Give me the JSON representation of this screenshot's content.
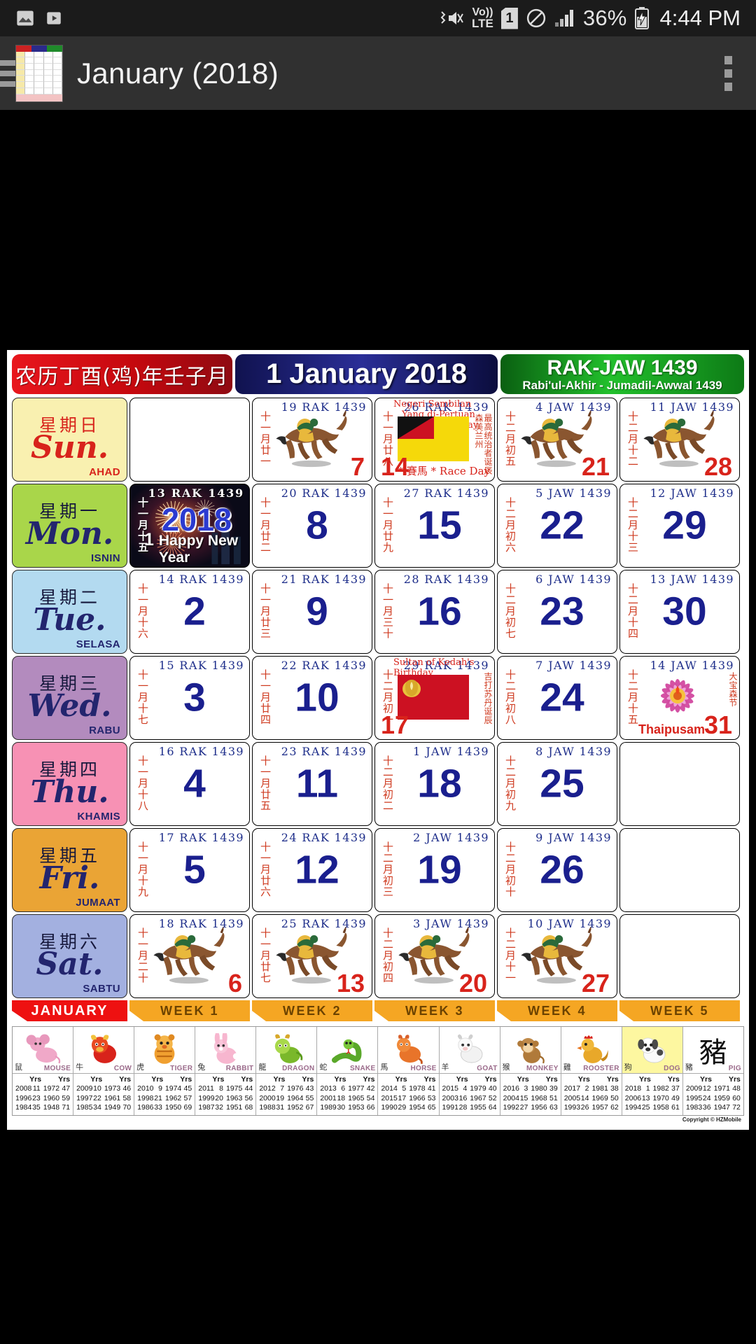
{
  "statusbar": {
    "icons": [
      "image-icon",
      "play-icon"
    ],
    "vibrate_icon": "vibrate-mute-icon",
    "volte": "Vo))\nLTE",
    "volte_line1": "Vo))",
    "volte_line2": "LTE",
    "sim": "1",
    "dnd_icon": "do-not-disturb-icon",
    "signal_icon": "signal-bars-icon",
    "battery_percent": "36%",
    "battery_icon": "battery-charging-icon",
    "time": "4:44 PM"
  },
  "appbar": {
    "menu_icon": "hamburger-menu-icon",
    "app_icon": "calendar-app-icon",
    "title": "January (2018)",
    "overflow_icon": "overflow-menu-icon"
  },
  "banner": {
    "chinese": "农历丁酉(鸡)年壬子月",
    "gregorian": "1 January 2018",
    "hijri_short": "RAK-JAW 1439",
    "hijri_long": "Rabi'ul-Akhir  -  Jumadil-Awwal 1439"
  },
  "weekdays": [
    {
      "cn": "星期日",
      "en": "Sun.",
      "ms": "AHAD",
      "bg": "#f9f0b0",
      "cn_color": "#d8231b",
      "en_color": "#d8231b",
      "ms_color": "#d8231b"
    },
    {
      "cn": "星期一",
      "en": "Mon.",
      "ms": "ISNIN",
      "bg": "#a9d64a",
      "cn_color": "#16183c",
      "en_color": "#23256e",
      "ms_color": "#23256e"
    },
    {
      "cn": "星期二",
      "en": "Tue.",
      "ms": "SELASA",
      "bg": "#b3daf0",
      "cn_color": "#16183c",
      "en_color": "#23256e",
      "ms_color": "#23256e"
    },
    {
      "cn": "星期三",
      "en": "Wed.",
      "ms": "RABU",
      "bg": "#b38bbe",
      "cn_color": "#16183c",
      "en_color": "#23256e",
      "ms_color": "#23256e"
    },
    {
      "cn": "星期四",
      "en": "Thu.",
      "ms": "KHAMIS",
      "bg": "#f791b4",
      "cn_color": "#16183c",
      "en_color": "#23256e",
      "ms_color": "#23256e"
    },
    {
      "cn": "星期五",
      "en": "Fri.",
      "ms": "JUMAAT",
      "bg": "#eaa435",
      "cn_color": "#16183c",
      "en_color": "#23256e",
      "ms_color": "#23256e"
    },
    {
      "cn": "星期六",
      "en": "Sat.",
      "ms": "SABTU",
      "bg": "#a3b0e0",
      "cn_color": "#16183c",
      "en_color": "#23256e",
      "ms_color": "#23256e"
    }
  ],
  "month_tag": "JANUARY",
  "week_tags": [
    "WEEK  1",
    "WEEK  2",
    "WEEK  3",
    "WEEK  4",
    "WEEK  5"
  ],
  "weeks": [
    [
      {
        "type": "empty"
      },
      {
        "type": "newyear",
        "day": "1",
        "hijri": "13 RAK 1439",
        "lunar": "十一月十五",
        "label": "Happy New Year"
      },
      {
        "type": "normal",
        "day": "2",
        "hijri": "14 RAK 1439",
        "lunar": "十一月十六"
      },
      {
        "type": "normal",
        "day": "3",
        "hijri": "15 RAK 1439",
        "lunar": "十一月十七"
      },
      {
        "type": "normal",
        "day": "4",
        "hijri": "16 RAK 1439",
        "lunar": "十一月十八"
      },
      {
        "type": "normal",
        "day": "5",
        "hijri": "17 RAK 1439",
        "lunar": "十一月十九"
      },
      {
        "type": "horse",
        "day": "6",
        "hijri": "18 RAK 1439",
        "lunar": "十一月二十"
      }
    ],
    [
      {
        "type": "horse",
        "day": "7",
        "hijri": "19 RAK 1439",
        "lunar": "十一月廿一"
      },
      {
        "type": "normal",
        "day": "8",
        "hijri": "20 RAK 1439",
        "lunar": "十一月廿二"
      },
      {
        "type": "normal",
        "day": "9",
        "hijri": "21 RAK 1439",
        "lunar": "十一月廿三"
      },
      {
        "type": "normal",
        "day": "10",
        "hijri": "22 RAK 1439",
        "lunar": "十一月廿四"
      },
      {
        "type": "normal",
        "day": "11",
        "hijri": "23 RAK 1439",
        "lunar": "十一月廿五"
      },
      {
        "type": "normal",
        "day": "12",
        "hijri": "24 RAK 1439",
        "lunar": "十一月廿六"
      },
      {
        "type": "horse",
        "day": "13",
        "hijri": "25 RAK 1439",
        "lunar": "十一月廿七"
      }
    ],
    [
      {
        "type": "flag-ns",
        "day": "14",
        "hijri": "26 RAK 1439",
        "lunar": "十一月廿八",
        "event_state": "Negeri Sembilan",
        "event_name": "Yang di-Pertuan Besar's Birthday",
        "event_cn": "最高统治者诞辰 森美兰州",
        "race": "*  賽馬  *  Race Day"
      },
      {
        "type": "normal",
        "day": "15",
        "hijri": "27 RAK 1439",
        "lunar": "十一月廿九"
      },
      {
        "type": "normal",
        "day": "16",
        "hijri": "28 RAK 1439",
        "lunar": "十一月三十"
      },
      {
        "type": "flag-kedah",
        "day": "17",
        "hijri": "29 RAK 1439",
        "lunar": "十二月初一",
        "event_name": "Sultan of Kedah's Birthday",
        "event_cn": "吉打苏丹诞辰"
      },
      {
        "type": "normal",
        "day": "18",
        "hijri": "1 JAW 1439",
        "lunar": "十二月初二"
      },
      {
        "type": "normal",
        "day": "19",
        "hijri": "2 JAW 1439",
        "lunar": "十二月初三"
      },
      {
        "type": "horse",
        "day": "20",
        "hijri": "3 JAW 1439",
        "lunar": "十二月初四"
      }
    ],
    [
      {
        "type": "horse",
        "day": "21",
        "hijri": "4 JAW 1439",
        "lunar": "十二月初五"
      },
      {
        "type": "normal",
        "day": "22",
        "hijri": "5 JAW 1439",
        "lunar": "十二月初六"
      },
      {
        "type": "normal",
        "day": "23",
        "hijri": "6 JAW 1439",
        "lunar": "十二月初七"
      },
      {
        "type": "normal",
        "day": "24",
        "hijri": "7 JAW 1439",
        "lunar": "十二月初八"
      },
      {
        "type": "normal",
        "day": "25",
        "hijri": "8 JAW 1439",
        "lunar": "十二月初九"
      },
      {
        "type": "normal",
        "day": "26",
        "hijri": "9 JAW 1439",
        "lunar": "十二月初十"
      },
      {
        "type": "horse",
        "day": "27",
        "hijri": "10 JAW 1439",
        "lunar": "十二月十一"
      }
    ],
    [
      {
        "type": "horse",
        "day": "28",
        "hijri": "11 JAW 1439",
        "lunar": "十二月十二"
      },
      {
        "type": "normal",
        "day": "29",
        "hijri": "12 JAW 1439",
        "lunar": "十二月十三"
      },
      {
        "type": "normal",
        "day": "30",
        "hijri": "13 JAW 1439",
        "lunar": "十二月十四"
      },
      {
        "type": "thaipusam",
        "day": "31",
        "hijri": "14 JAW 1439",
        "lunar": "十二月十五",
        "event_name": "Thaipusam",
        "event_cn": "大宝森节"
      },
      {
        "type": "empty"
      },
      {
        "type": "empty"
      },
      {
        "type": "empty"
      }
    ]
  ],
  "zodiac": [
    {
      "glyph": "鼠",
      "name": "MOUSE",
      "art": "mouse-icon",
      "rows": [
        [
          "2008",
          "11",
          "1972",
          "47"
        ],
        [
          "1996",
          "23",
          "1960",
          "59"
        ],
        [
          "1984",
          "35",
          "1948",
          "71"
        ]
      ]
    },
    {
      "glyph": "牛",
      "name": "COW",
      "art": "cow-icon",
      "rows": [
        [
          "2009",
          "10",
          "1973",
          "46"
        ],
        [
          "1997",
          "22",
          "1961",
          "58"
        ],
        [
          "1985",
          "34",
          "1949",
          "70"
        ]
      ]
    },
    {
      "glyph": "虎",
      "name": "TIGER",
      "art": "tiger-icon",
      "rows": [
        [
          "2010",
          "9",
          "1974",
          "45"
        ],
        [
          "1998",
          "21",
          "1962",
          "57"
        ],
        [
          "1986",
          "33",
          "1950",
          "69"
        ]
      ]
    },
    {
      "glyph": "兔",
      "name": "RABBIT",
      "art": "rabbit-icon",
      "rows": [
        [
          "2011",
          "8",
          "1975",
          "44"
        ],
        [
          "1999",
          "20",
          "1963",
          "56"
        ],
        [
          "1987",
          "32",
          "1951",
          "68"
        ]
      ]
    },
    {
      "glyph": "龍",
      "name": "DRAGON",
      "art": "dragon-icon",
      "rows": [
        [
          "2012",
          "7",
          "1976",
          "43"
        ],
        [
          "2000",
          "19",
          "1964",
          "55"
        ],
        [
          "1988",
          "31",
          "1952",
          "67"
        ]
      ]
    },
    {
      "glyph": "蛇",
      "name": "SNAKE",
      "art": "snake-icon",
      "rows": [
        [
          "2013",
          "6",
          "1977",
          "42"
        ],
        [
          "2001",
          "18",
          "1965",
          "54"
        ],
        [
          "1989",
          "30",
          "1953",
          "66"
        ]
      ]
    },
    {
      "glyph": "馬",
      "name": "HORSE",
      "art": "horse-icon",
      "rows": [
        [
          "2014",
          "5",
          "1978",
          "41"
        ],
        [
          "2015",
          "17",
          "1966",
          "53"
        ],
        [
          "1990",
          "29",
          "1954",
          "65"
        ]
      ]
    },
    {
      "glyph": "羊",
      "name": "GOAT",
      "art": "goat-icon",
      "rows": [
        [
          "2015",
          "4",
          "1979",
          "40"
        ],
        [
          "2003",
          "16",
          "1967",
          "52"
        ],
        [
          "1991",
          "28",
          "1955",
          "64"
        ]
      ]
    },
    {
      "glyph": "猴",
      "name": "MONKEY",
      "art": "monkey-icon",
      "rows": [
        [
          "2016",
          "3",
          "1980",
          "39"
        ],
        [
          "2004",
          "15",
          "1968",
          "51"
        ],
        [
          "1992",
          "27",
          "1956",
          "63"
        ]
      ]
    },
    {
      "glyph": "雞",
      "name": "ROOSTER",
      "art": "rooster-icon",
      "rows": [
        [
          "2017",
          "2",
          "1981",
          "38"
        ],
        [
          "2005",
          "14",
          "1969",
          "50"
        ],
        [
          "1993",
          "26",
          "1957",
          "62"
        ]
      ]
    },
    {
      "glyph": "狗",
      "name": "DOG",
      "art": "dog-icon",
      "rows": [
        [
          "2018",
          "1",
          "1982",
          "37"
        ],
        [
          "2006",
          "13",
          "1970",
          "49"
        ],
        [
          "1994",
          "25",
          "1958",
          "61"
        ]
      ]
    },
    {
      "glyph": "豬",
      "name": "PIG",
      "art": "pig-text",
      "rows": [
        [
          "2009",
          "12",
          "1971",
          "48"
        ],
        [
          "1995",
          "24",
          "1959",
          "60"
        ],
        [
          "1983",
          "36",
          "1947",
          "72"
        ]
      ]
    }
  ],
  "copyright": "Copyright © HZMobile"
}
